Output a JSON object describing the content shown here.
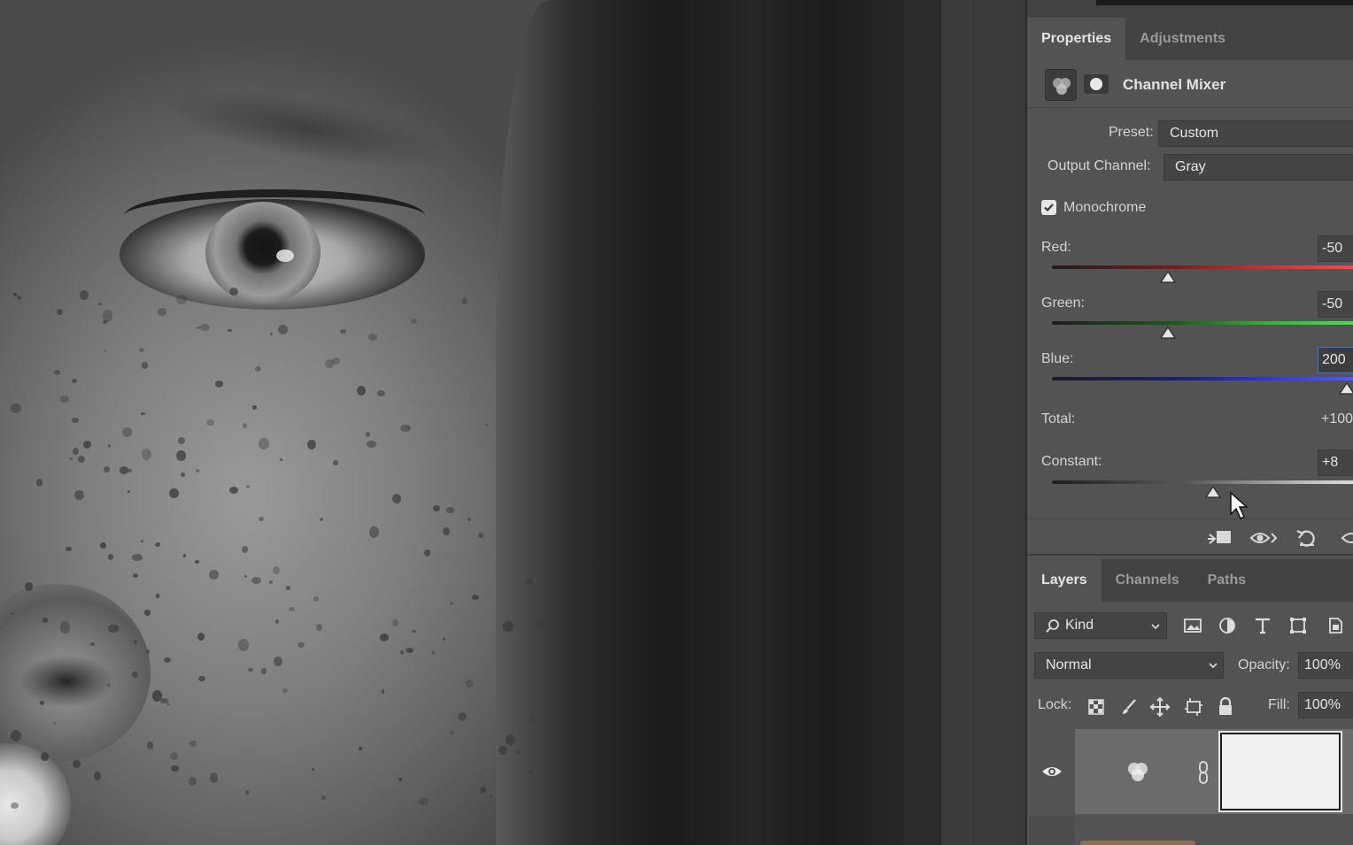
{
  "properties_panel": {
    "tabs": [
      {
        "label": "Properties",
        "active": true
      },
      {
        "label": "Adjustments",
        "active": false
      }
    ],
    "adjustment_title": "Channel Mixer",
    "adjustment_icon": "channel-mixer-icon",
    "preset": {
      "label": "Preset:",
      "value": "Custom"
    },
    "output_channel": {
      "label": "Output Channel:",
      "value": "Gray"
    },
    "monochrome": {
      "label": "Monochrome",
      "checked": true
    },
    "sliders": {
      "red": {
        "label": "Red:",
        "value": "-50",
        "level_percent": -50
      },
      "green": {
        "label": "Green:",
        "value": "-50",
        "level_percent": -50
      },
      "blue": {
        "label": "Blue:",
        "value": "200",
        "level_percent": 200
      },
      "constant": {
        "label": "Constant:",
        "value": "+8",
        "level_percent": 8
      }
    },
    "total": {
      "label": "Total:",
      "value": "+100"
    },
    "footer_icons": [
      "clip-to-layer-icon",
      "view-previous-state-icon",
      "reset-icon",
      "visibility-icon"
    ]
  },
  "layers_panel": {
    "tabs": [
      {
        "label": "Layers",
        "active": true
      },
      {
        "label": "Channels",
        "active": false
      },
      {
        "label": "Paths",
        "active": false
      }
    ],
    "filter": {
      "label": "Kind"
    },
    "filter_icons": [
      "pixel-layer-filter-icon",
      "adjustment-layer-filter-icon",
      "type-layer-filter-icon",
      "shape-layer-filter-icon",
      "smart-object-filter-icon"
    ],
    "blend_mode": "Normal",
    "opacity": {
      "label": "Opacity:",
      "value": "100%"
    },
    "lock": {
      "label": "Lock:"
    },
    "fill": {
      "label": "Fill:",
      "value": "100%"
    }
  },
  "colors": {
    "panel_bg": "#535353",
    "tab_bar_bg": "#424242",
    "focus_accent": "#3a7ce0",
    "red_track": "#e03434",
    "green_track": "#3ec93e",
    "blue_track": "#3c3cff"
  }
}
